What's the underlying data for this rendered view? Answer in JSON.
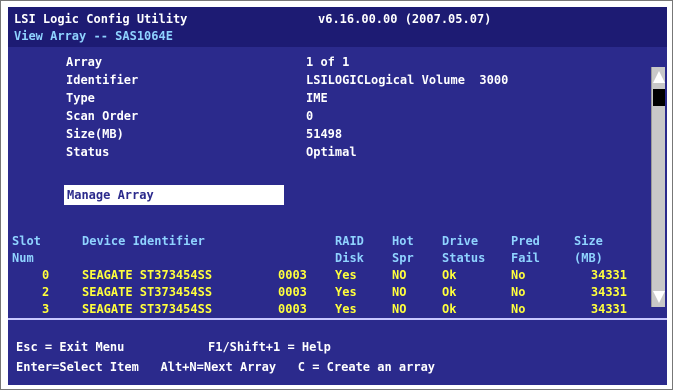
{
  "header": {
    "app_title": "LSI Logic Config Utility",
    "version": "v6.16.00.00 (2007.05.07)",
    "screen_title": "View Array -- SAS1064E"
  },
  "array_info": {
    "rows": [
      {
        "label": "Array",
        "value": "1 of 1"
      },
      {
        "label": "Identifier",
        "value": "LSILOGICLogical Volume  3000"
      },
      {
        "label": "Type",
        "value": "IME"
      },
      {
        "label": "Scan Order",
        "value": "0"
      },
      {
        "label": "Size(MB)",
        "value": "51498"
      },
      {
        "label": "Status",
        "value": "Optimal"
      }
    ],
    "manage_label": "Manage Array"
  },
  "devices": {
    "headers": {
      "slot": "Slot",
      "slot2": "Num",
      "device": "Device Identifier",
      "raid": "RAID",
      "raid2": "Disk",
      "hot": "Hot",
      "hot2": "Spr",
      "drive": "Drive",
      "drive2": "Status",
      "pred": "Pred",
      "pred2": "Fail",
      "size": "Size",
      "size2": "(MB)"
    },
    "rows": [
      {
        "slot": "0",
        "device": "SEAGATE ST373454SS",
        "rev": "0003",
        "raid": "Yes",
        "hot": "NO",
        "status": "Ok",
        "pred": "No",
        "size": "34331"
      },
      {
        "slot": "2",
        "device": "SEAGATE ST373454SS",
        "rev": "0003",
        "raid": "Yes",
        "hot": "NO",
        "status": "Ok",
        "pred": "No",
        "size": "34331"
      },
      {
        "slot": "3",
        "device": "SEAGATE ST373454SS",
        "rev": "0003",
        "raid": "Yes",
        "hot": "NO",
        "status": "Ok",
        "pred": "No",
        "size": "34331"
      }
    ]
  },
  "footer": {
    "line1_a": "Esc = Exit Menu",
    "line1_b": "F1/Shift+1 = Help",
    "line2": "Enter=Select Item   Alt+N=Next Array   C = Create an array"
  },
  "colors": {
    "background": "#2b2a8c",
    "header_bg": "#1d1b73",
    "label_text": "#ffffff",
    "heading_text": "#8fd3ff",
    "device_text": "#ffff3c"
  }
}
